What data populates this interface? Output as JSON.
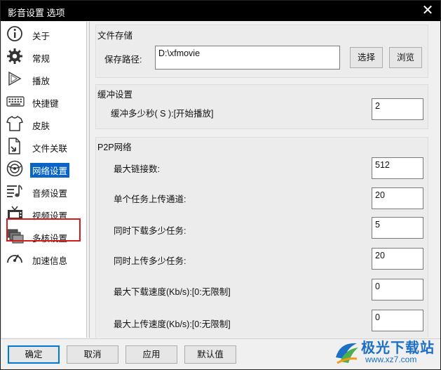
{
  "window": {
    "title": "影音设置 选项"
  },
  "sidebar": {
    "items": [
      {
        "label": "关于",
        "icon": "info-icon"
      },
      {
        "label": "常规",
        "icon": "gear-icon"
      },
      {
        "label": "播放",
        "icon": "play-icon"
      },
      {
        "label": "快捷键",
        "icon": "keyboard-icon"
      },
      {
        "label": "皮肤",
        "icon": "tshirt-icon"
      },
      {
        "label": "文件关联",
        "icon": "file-link-icon"
      },
      {
        "label": "网络设置",
        "icon": "network-icon",
        "active": true
      },
      {
        "label": "音频设置",
        "icon": "audio-icon"
      },
      {
        "label": "视频设置",
        "icon": "tv-icon",
        "highlighted": true
      },
      {
        "label": "多核设置",
        "icon": "multicore-icon"
      },
      {
        "label": "加速信息",
        "icon": "speedometer-icon"
      }
    ]
  },
  "storage": {
    "title": "文件存储",
    "path_label": "保存路径:",
    "path_value": "D:\\xfmovie",
    "choose_label": "选择",
    "browse_label": "浏览"
  },
  "buffer": {
    "title": "缓冲设置",
    "seconds_label": "缓冲多少秒( S ):[开始播放]",
    "seconds_value": "2"
  },
  "p2p": {
    "title": "P2P网络",
    "fields": [
      {
        "label": "最大链接数:",
        "value": "512"
      },
      {
        "label": "单个任务上传通道:",
        "value": "20"
      },
      {
        "label": "同时下载多少任务:",
        "value": "5"
      },
      {
        "label": "同时上传多少任务:",
        "value": "20"
      },
      {
        "label": "最大下载速度(Kb/s):[0:无限制]",
        "value": "0"
      },
      {
        "label": "最大上传速度(Kb/s):[0:无限制]",
        "value": "0"
      }
    ]
  },
  "footer": {
    "ok": "确定",
    "cancel": "取消",
    "apply": "应用",
    "default": "默认值"
  },
  "watermark": {
    "text": "极光下载站",
    "url": "www.xz7.com"
  },
  "colors": {
    "accent": "#0a64c8",
    "highlight_border": "#d9191c",
    "titlebar": "#000000"
  }
}
